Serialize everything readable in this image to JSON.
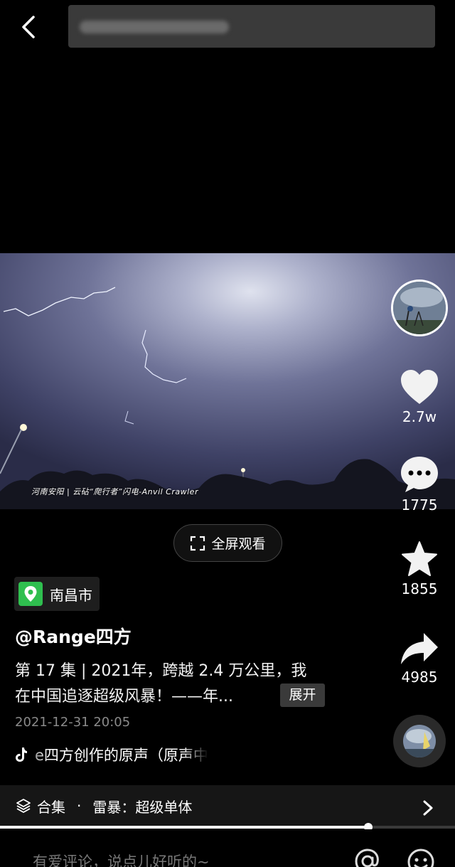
{
  "header": {
    "back_icon": "chevron-left-icon",
    "search_placeholder": ""
  },
  "video": {
    "caption": "河南安阳 | 云砧“爬行者”闪电-Anvil Crawler"
  },
  "rail": {
    "likes": "2.7w",
    "comments": "1775",
    "favorites": "1855",
    "shares": "4985"
  },
  "fullscreen_label": "全屏观看",
  "location": "南昌市",
  "author_name": "@Range四方",
  "description": {
    "line1": "第 17 集 | 2021年，跨越 2.4 万公里，我",
    "line2": "在中国追逐超级风暴！——年..."
  },
  "expand_label": "展开",
  "timestamp": "2021-12-31 20:05",
  "music_text": "e四方创作的原声（原声中",
  "collection": {
    "label": "合集",
    "separator": "·",
    "title": "雷暴：超级单体"
  },
  "progress": {
    "fraction": 0.81
  },
  "comment_placeholder": "有爱评论，说点儿好听的~",
  "colors": {
    "location_pin": "#2fbf4f",
    "background": "#000000"
  }
}
